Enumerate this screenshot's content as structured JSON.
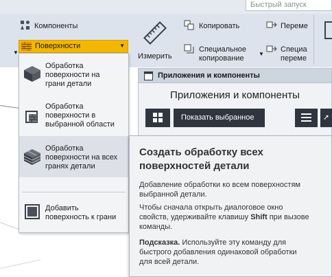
{
  "search": {
    "placeholder": "Быстрый запуск"
  },
  "ribbon": {
    "components_label": "Компоненты",
    "surfaces_label": "Поверхности",
    "measure_label": "Измерить",
    "copy_label": "Копировать",
    "special_copy_line1": "Специальное",
    "special_copy_line2": "копирование",
    "move_label": "Переме",
    "special_move_line1": "Специа",
    "special_move_line2": "переме"
  },
  "panel": {
    "header": "Приложения и компоненты",
    "title": "Приложения и компоненты",
    "show_selected": "Показать выбранное"
  },
  "menu": {
    "items": [
      {
        "line1": "Обработка",
        "line2": "поверхности на",
        "line3": "грани детали"
      },
      {
        "line1": "Обработка",
        "line2": "поверхности в",
        "line3": "выбранной области"
      },
      {
        "line1": "Обработка",
        "line2": "поверхности на всех",
        "line3": "гранях детали"
      },
      {
        "line1": "Добавить",
        "line2": "поверхность к грани"
      }
    ]
  },
  "tooltip": {
    "title_line1": "Создать обработку всех",
    "title_line2": "поверхностей детали",
    "desc_line1": "Добавление обработки ко всем поверхностям",
    "desc_line2": "выбранной детали.",
    "shift_pre": "Чтобы сначала открыть диалоговое окно",
    "shift_mid": "свойств, удерживайте клавишу ",
    "shift_key": "Shift",
    "shift_post": " при вызове",
    "shift_end": "команды.",
    "hint_label": "Подсказка.",
    "hint_line1": " Используйте эту команду для",
    "hint_line2": "быстрого добавления одинаковой обработки",
    "hint_line3": "для всей детали."
  },
  "colors": {
    "highlight": "#f2b705",
    "ribbon": "#dde3ec",
    "dark_button": "#2f3640"
  }
}
